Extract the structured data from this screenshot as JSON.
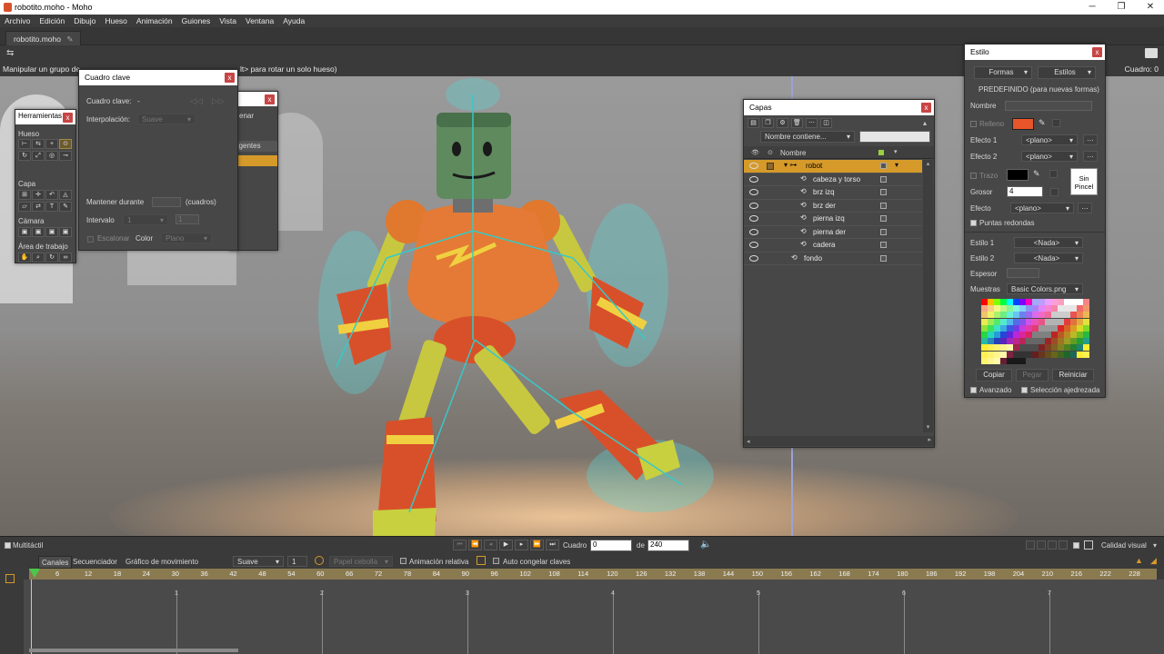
{
  "window": {
    "title": "robotito.moho - Moho"
  },
  "menu": [
    "Archivo",
    "Edición",
    "Dibujo",
    "Hueso",
    "Animación",
    "Guiones",
    "Vista",
    "Ventana",
    "Ayuda"
  ],
  "document_tab": "robotito.moho",
  "status": {
    "left": "Manipular un grupo de",
    "right": "lt> para rotar un solo hueso)",
    "frame_label": "Cuadro: 0"
  },
  "herramientas": {
    "title": "Herramientas",
    "sections": [
      "Hueso",
      "Capa",
      "Cámara",
      "Área de trabajo"
    ]
  },
  "cuadro_clave": {
    "title": "Cuadro clave",
    "keyframe_label": "Cuadro clave:",
    "keyframe_value": "-",
    "interp_label": "Interpolación:",
    "interp_value": "Suave",
    "hold_label": "Mantener durante",
    "hold_unit": "(cuadros)",
    "interval_label": "Intervalo",
    "interval_value": "1",
    "interval_field": "1",
    "stagger_label": "Escalonar",
    "color_label": "Color",
    "color_value": "Plano",
    "behind_text_1": "enar",
    "behind_text_2": "ligentes"
  },
  "capas": {
    "title": "Capas",
    "filter_dropdown": "Nombre contiene...",
    "name_header": "Nombre",
    "layers": [
      {
        "name": "robot",
        "level": 0,
        "selected": true
      },
      {
        "name": "cabeza y torso",
        "level": 1,
        "selected": false
      },
      {
        "name": "brz izq",
        "level": 1,
        "selected": false
      },
      {
        "name": "brz der",
        "level": 1,
        "selected": false
      },
      {
        "name": "pierna izq",
        "level": 1,
        "selected": false
      },
      {
        "name": "pierna der",
        "level": 1,
        "selected": false
      },
      {
        "name": "cadera",
        "level": 1,
        "selected": false
      },
      {
        "name": "fondo",
        "level": 0,
        "selected": false
      }
    ]
  },
  "estilo": {
    "title": "Estilo",
    "formas": "Formas",
    "estilos": "Estilos",
    "predefinido": "PREDEFINIDO (para nuevas formas)",
    "nombre_label": "Nombre",
    "relleno_label": "Relleno",
    "fill_color": "#e8552a",
    "efecto1_label": "Efecto 1",
    "efecto1_value": "<plano>",
    "efecto2_label": "Efecto 2",
    "efecto2_value": "<plano>",
    "trazo_label": "Trazo",
    "stroke_color": "#000000",
    "sin_pincel": "Sin Pincel",
    "grosor_label": "Grosor",
    "grosor_value": "4",
    "efecto_label": "Efecto",
    "efecto_value": "<plano>",
    "puntas_label": "Puntas redondas",
    "estilo1_label": "Estilo 1",
    "estilo1_value": "<Nada>",
    "estilo2_label": "Estilo 2",
    "estilo2_value": "<Nada>",
    "espesor_label": "Espesor",
    "muestras_label": "Muestras",
    "muestras_value": "Basic Colors.png",
    "copiar": "Copiar",
    "pegar": "Pegar",
    "reiniciar": "Reiniciar",
    "avanzado": "Avanzado",
    "seleccion": "Selección ajedrezada"
  },
  "timeline": {
    "multitactil": "Multitáctil",
    "cuadro_label": "Cuadro",
    "cuadro_value": "0",
    "de_label": "de",
    "total_value": "240",
    "calidad": "Calidad visual",
    "tabs": [
      "Canales",
      "Secuenciador",
      "Gráfico de movimiento"
    ],
    "interp": "Suave",
    "interp_num": "1",
    "papel_cebolla": "Papel cebolla",
    "animacion_relativa": "Animación relativa",
    "auto_congelar": "Auto congelar claves",
    "ruler_labels": [
      "6",
      "12",
      "18",
      "24",
      "30",
      "36",
      "42",
      "48",
      "54",
      "60",
      "66",
      "72",
      "78",
      "84",
      "90",
      "96",
      "102",
      "108",
      "114",
      "120",
      "126",
      "132",
      "138",
      "144",
      "150",
      "156",
      "162",
      "168",
      "174",
      "180",
      "186",
      "192",
      "198",
      "204",
      "210",
      "216",
      "222",
      "228"
    ],
    "second_marks": [
      "1",
      "2",
      "3",
      "4",
      "5",
      "6",
      "7"
    ]
  }
}
